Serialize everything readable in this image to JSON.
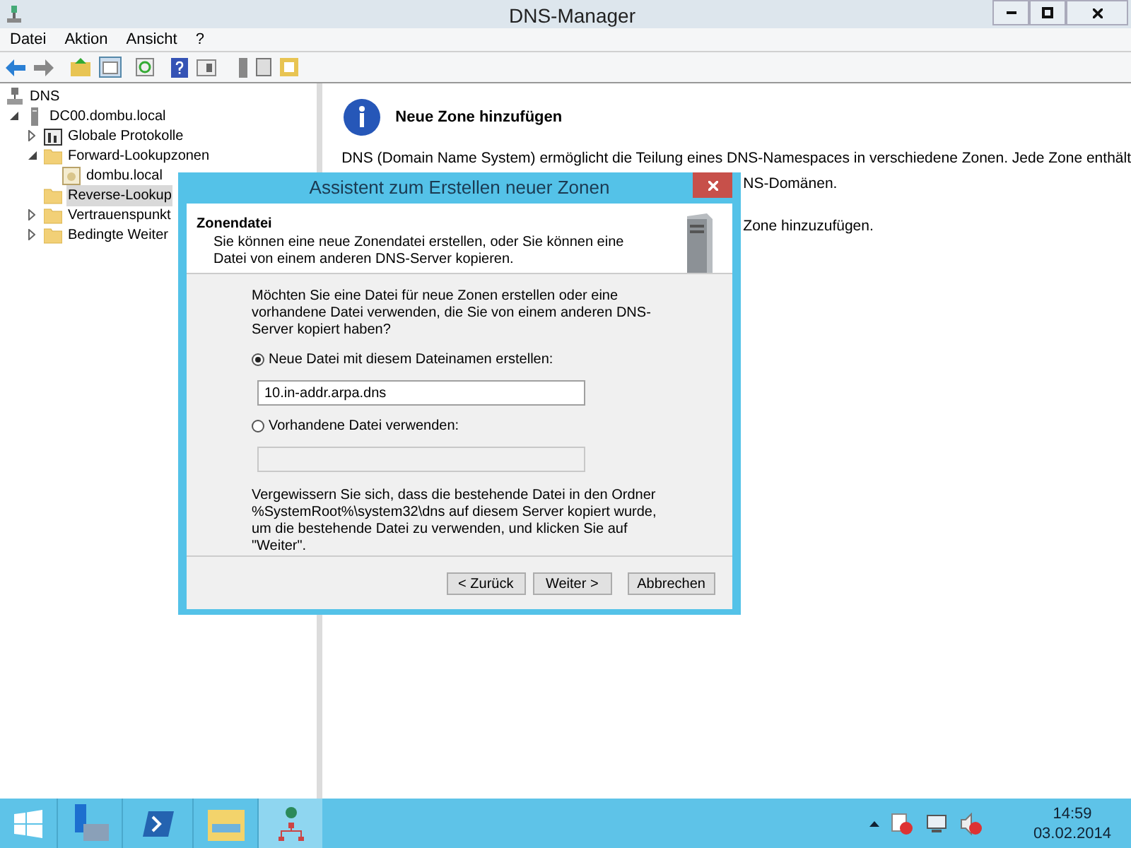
{
  "window": {
    "title": "DNS-Manager"
  },
  "menu": [
    "Datei",
    "Aktion",
    "Ansicht",
    "?"
  ],
  "tree": [
    {
      "label": "DNS",
      "kind": "dns",
      "selected": false,
      "children": [
        {
          "label": "DC00.dombu.local",
          "kind": "server",
          "selected": false,
          "expanded": true,
          "children": [
            {
              "label": "Globale Protokolle",
              "kind": "log",
              "selected": false,
              "expanded": false
            },
            {
              "label": "Forward-Lookupzonen",
              "kind": "folder",
              "selected": false,
              "expanded": true,
              "children": [
                {
                  "label": "dombu.local",
                  "kind": "zone",
                  "selected": false
                }
              ]
            },
            {
              "label": "Reverse-Lookup",
              "kind": "folder",
              "selected": true
            },
            {
              "label": "Vertrauenspunkt",
              "kind": "folder",
              "selected": false,
              "expanded": false
            },
            {
              "label": "Bedingte Weiter",
              "kind": "folder",
              "selected": false,
              "expanded": false
            }
          ]
        }
      ]
    }
  ],
  "info": {
    "heading": "Neue Zone hinzufügen",
    "line_1": "DNS (Domain Name System) ermöglicht die Teilung eines DNS-Namespaces in verschiedene Zonen. Jede Zone enthält",
    "line_2": "NS-Domänen.",
    "line_3": "Zone hinzuzufügen."
  },
  "dialog": {
    "title": "Assistent zum Erstellen neuer Zonen",
    "heading": "Zonendatei",
    "subheading": "Sie können eine neue Zonendatei erstellen, oder Sie können eine Datei von einem anderen DNS-Server kopieren.",
    "question": "Möchten Sie eine Datei für neue Zonen erstellen oder eine vorhandene Datei verwenden, die Sie von einem anderen DNS-Server kopiert haben?",
    "options": [
      {
        "label": "Neue Datei mit diesem Dateinamen erstellen:",
        "selected": true,
        "value": "10.in-addr.arpa.dns"
      },
      {
        "label": "Vorhandene Datei verwenden:",
        "selected": false
      }
    ],
    "note": "Vergewissern Sie sich, dass die bestehende Datei in den Ordner %SystemRoot%\\system32\\dns auf diesem Server kopiert wurde, um die bestehende Datei zu verwenden, und klicken Sie auf \"Weiter\".",
    "buttons": [
      "< Zurück",
      "Weiter >",
      "Abbrechen"
    ]
  },
  "taskbar": {
    "time": "14:59",
    "date": "03.02.2014"
  }
}
